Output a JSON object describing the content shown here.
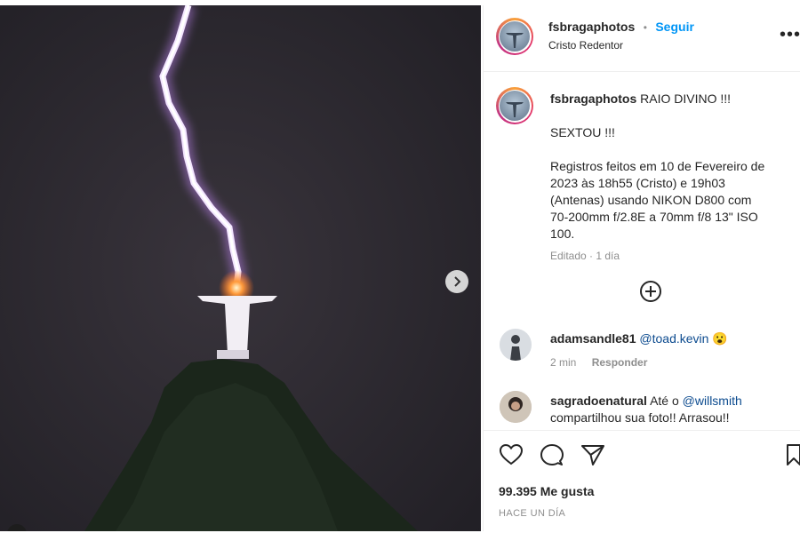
{
  "post": {
    "username": "fsbragaphotos",
    "dot": "•",
    "follow_label": "Seguir",
    "location": "Cristo Redentor",
    "more_label": "•••"
  },
  "caption": {
    "username": "fsbragaphotos",
    "title": "RAIO DIVINO !!!",
    "line2": "SEXTOU !!!",
    "body_lines": [
      "Registros feitos em 10 de Fevereiro de",
      "2023 às 18h55 (Cristo) e 19h03",
      "(Antenas) usando NIKON D800 com",
      "70-200mm f/2.8E a 70mm f/8 13\" ISO",
      "100."
    ],
    "meta": "Editado · 1 día"
  },
  "comments": [
    {
      "username": "adamsandle81",
      "mention": "@toad.kevin",
      "emoji": "😮",
      "time": "2 min",
      "reply_label": "Responder"
    },
    {
      "username": "sagradoenatural",
      "text_before": "Até o",
      "mention": "@willsmith",
      "text_after": "compartilhou sua foto!! Arrasou!!"
    }
  ],
  "stats": {
    "likes": "99.395 Me gusta",
    "date": "HACE UN DÍA"
  },
  "icons": [
    "heart-icon",
    "comment-icon",
    "share-icon",
    "bookmark-icon",
    "add-comment-icon",
    "next-icon",
    "more-icon"
  ],
  "colors": {
    "follow": "#0095f6",
    "mention": "#0c4b8f",
    "muted": "#8e8e8e"
  }
}
